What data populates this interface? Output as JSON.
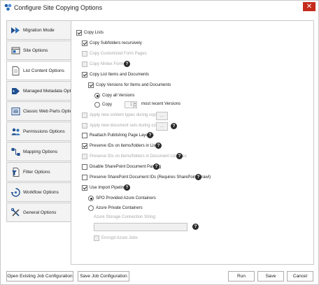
{
  "window": {
    "title": "Configure Site Copying Options",
    "close_label": "✕"
  },
  "tabs": [
    {
      "label": "Migration Mode",
      "icon": "arrows-icon"
    },
    {
      "label": "Site Options",
      "icon": "site-icon"
    },
    {
      "label": "List Content Options",
      "icon": "document-icon"
    },
    {
      "label": "Managed Metadata Options",
      "icon": "tag-icon"
    },
    {
      "label": "Classic Web Parts Options",
      "icon": "web-part-icon"
    },
    {
      "label": "Permissions Options",
      "icon": "users-icon"
    },
    {
      "label": "Mapping Options",
      "icon": "mapping-icon"
    },
    {
      "label": "Filter Options",
      "icon": "filter-icon"
    },
    {
      "label": "Workflow Options",
      "icon": "workflow-icon"
    },
    {
      "label": "General Options",
      "icon": "tools-icon"
    }
  ],
  "active_tab": "List Content Options",
  "options": {
    "copy_lists": "Copy Lists",
    "copy_subfolders": "Copy Subfolders recursively",
    "copy_customized_forms": "Copy Customized Form Pages",
    "copy_nintex_forms": "Copy Nintex Forms",
    "copy_list_items": "Copy List Items and Documents",
    "copy_versions": "Copy Versions for Items and Documents",
    "copy_all_versions": "Copy all Versions",
    "copy_n_prefix": "Copy",
    "copy_n_value": "1",
    "copy_n_suffix": "most recent Versions",
    "apply_content_types": "Apply new content types during copy",
    "apply_document_sets": "Apply new document sets during copy",
    "dots_label": "...",
    "reattach_layouts": "Reattach Publishing Page Layouts",
    "preserve_ids_lists": "Preserve IDs on items/folders in Lists",
    "preserve_ids_libraries": "Preserve IDs on items/folders in Document Libraries",
    "disable_doc_parsing": "Disable SharePoint Document Parsing",
    "preserve_doc_ids": "Preserve SharePoint Document IDs (Requires SharePoint Crawl)",
    "use_import_pipeline": "Use Import Pipeline",
    "spo_containers": "SPO Provided Azure Containers",
    "azure_private": "Azure Private Containers",
    "azure_conn_label": "Azure Storage Connection String:",
    "encrypt_azure": "Encrypt Azure Jobs",
    "help_glyph": "?"
  },
  "footer": {
    "open_existing": "Open Existing Job Configuration",
    "save_job": "Save Job Configuration",
    "run": "Run",
    "save": "Save",
    "cancel": "Cancel"
  },
  "colors": {
    "close": "#c42b1c",
    "accent": "#1f5fa8"
  }
}
